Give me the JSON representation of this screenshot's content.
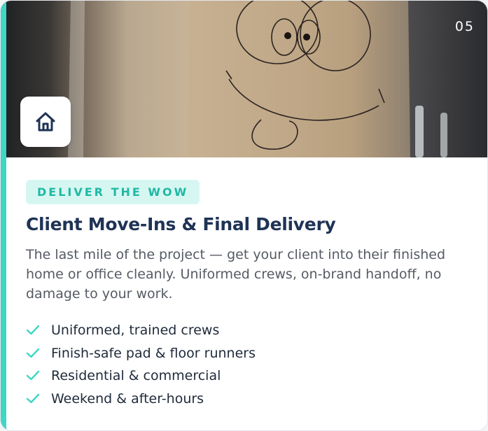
{
  "card": {
    "number": "05",
    "tag": "DELIVER THE WOW",
    "title": "Client Move-Ins & Final Delivery",
    "description": "The last mile of the project — get your client into their finished home or office cleanly. Uniformed crews, on-brand handoff, no damage to your work.",
    "features": [
      "Uniformed, trained crews",
      "Finish-safe pad & floor runners",
      "Residential & commercial",
      "Weekend & after-hours"
    ],
    "icon": "home-icon",
    "feature_icon": "check-icon",
    "colors": {
      "accent": "#3fd6c4",
      "tag_bg": "#d6f7f1",
      "tag_text": "#1fb8a5",
      "title": "#1f3356",
      "body": "#555a63"
    }
  }
}
